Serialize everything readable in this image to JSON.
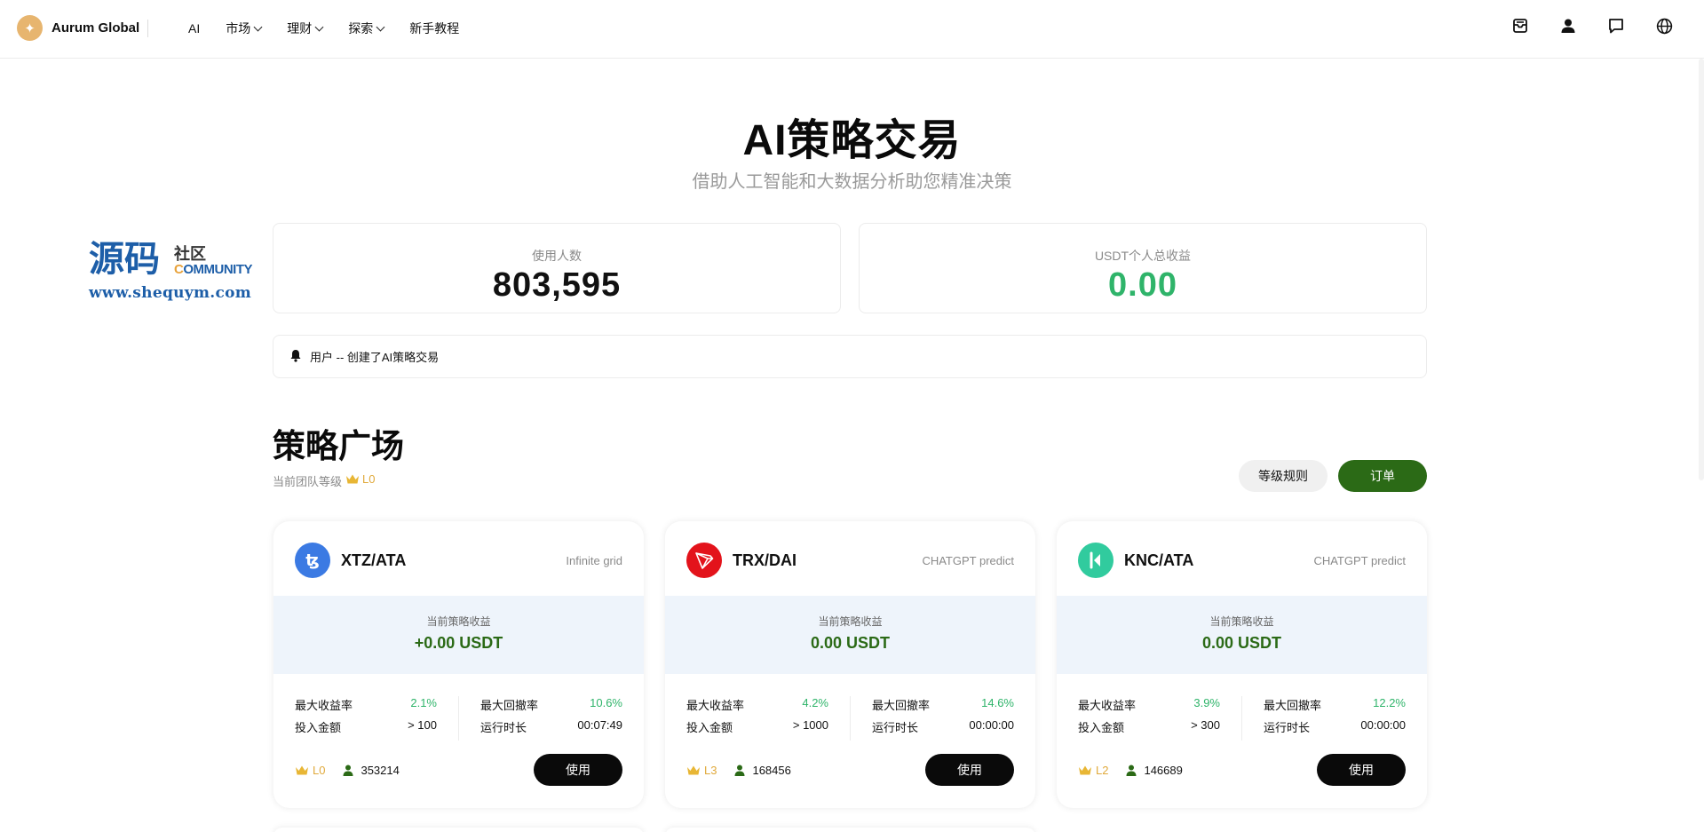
{
  "header": {
    "brand_name": "Aurum Global",
    "brand_logo_glyph": "✦",
    "nav": [
      {
        "label": "AI",
        "has_dropdown": false
      },
      {
        "label": "市场",
        "has_dropdown": true
      },
      {
        "label": "理财",
        "has_dropdown": true
      },
      {
        "label": "探索",
        "has_dropdown": true
      },
      {
        "label": "新手教程",
        "has_dropdown": false
      }
    ],
    "icons": [
      "inbox-icon",
      "user-icon",
      "chat-icon",
      "globe-icon"
    ]
  },
  "hero": {
    "title": "AI策略交易",
    "subtitle": "借助人工智能和大数据分析助您精准决策"
  },
  "watermark": {
    "big": "源码",
    "small": "社区",
    "community_c": "C",
    "community_rest": "OMMUNITY",
    "url": "www.shequym.com"
  },
  "stats": {
    "users_label": "使用人数",
    "users_value": "803,595",
    "income_label": "USDT个人总收益",
    "income_value": "0.00"
  },
  "notice": {
    "text": "用户 -- 创建了AI策略交易"
  },
  "plaza": {
    "title": "策略广场",
    "team_level_label": "当前团队等级",
    "team_level": "L0",
    "rules_button": "等级规则",
    "orders_button": "订单"
  },
  "cards": [
    {
      "pair": "XTZ/ATA",
      "type": "Infinite grid",
      "icon_color": "#3b7ae3",
      "icon_glyph": "ꜩ",
      "profit_label": "当前策略收益",
      "profit": "+0.00 USDT",
      "max_yield_label": "最大收益率",
      "max_yield": "2.1%",
      "max_drawdown_label": "最大回撤率",
      "max_drawdown": "10.6%",
      "invest_label": "投入金额",
      "invest": "> 100",
      "runtime_label": "运行时长",
      "runtime": "00:07:49",
      "level": "L0",
      "users": "353214",
      "use_button": "使用"
    },
    {
      "pair": "TRX/DAI",
      "type": "CHATGPT predict",
      "icon_color": "#e3131b",
      "icon_glyph": "▽",
      "profit_label": "当前策略收益",
      "profit": "0.00 USDT",
      "max_yield_label": "最大收益率",
      "max_yield": "4.2%",
      "max_drawdown_label": "最大回撤率",
      "max_drawdown": "14.6%",
      "invest_label": "投入金额",
      "invest": "> 1000",
      "runtime_label": "运行时长",
      "runtime": "00:00:00",
      "level": "L3",
      "users": "168456",
      "use_button": "使用"
    },
    {
      "pair": "KNC/ATA",
      "type": "CHATGPT predict",
      "icon_color": "#31cb9e",
      "icon_glyph": "K",
      "profit_label": "当前策略收益",
      "profit": "0.00 USDT",
      "max_yield_label": "最大收益率",
      "max_yield": "3.9%",
      "max_drawdown_label": "最大回撤率",
      "max_drawdown": "12.2%",
      "invest_label": "投入金额",
      "invest": "> 300",
      "runtime_label": "运行时长",
      "runtime": "00:00:00",
      "level": "L2",
      "users": "146689",
      "use_button": "使用"
    }
  ],
  "colors": {
    "accent_green": "#2b6a16",
    "positive_green": "#2fb46a",
    "crown_gold": "#e0a93b"
  }
}
